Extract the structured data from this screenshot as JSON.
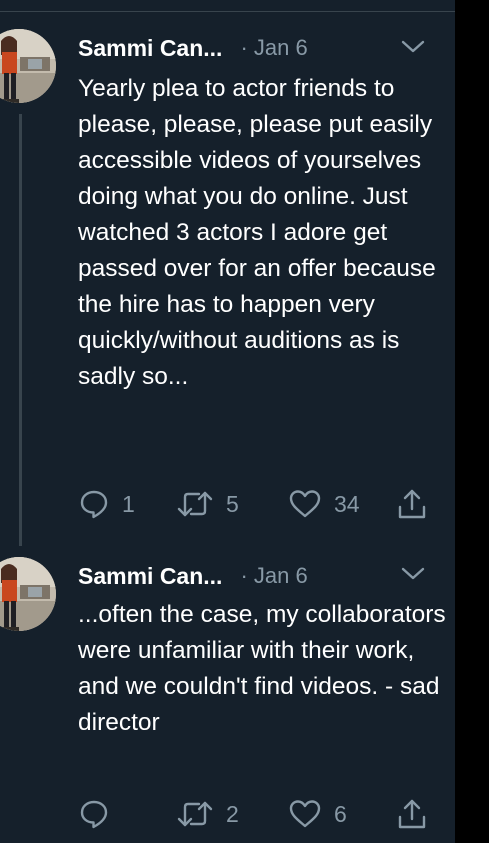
{
  "tweets": [
    {
      "author": "Sammi Can...",
      "meta": "· Jan 6",
      "text": "Yearly plea to actor friends to please, please, please put easily accessible videos of yourselves doing what you do online. Just watched 3 actors I adore get passed over for an offer because the hire has to happen very quickly/without auditions as is sadly so...",
      "replies": "1",
      "retweets": "5",
      "likes": "34"
    },
    {
      "author": "Sammi Can...",
      "meta": "· Jan 6",
      "text": "...often the case, my collaborators were unfamiliar with their work, and we couldn't find videos. - sad director",
      "replies": "",
      "retweets": "2",
      "likes": "6"
    }
  ],
  "icons": {
    "reply": "reply-icon",
    "retweet": "retweet-icon",
    "like": "heart-icon",
    "share": "share-icon",
    "menu": "chevron-down-icon"
  },
  "colors": {
    "background": "#15202b",
    "text": "#ffffff",
    "muted": "#8899a6",
    "divider": "#38444d"
  }
}
